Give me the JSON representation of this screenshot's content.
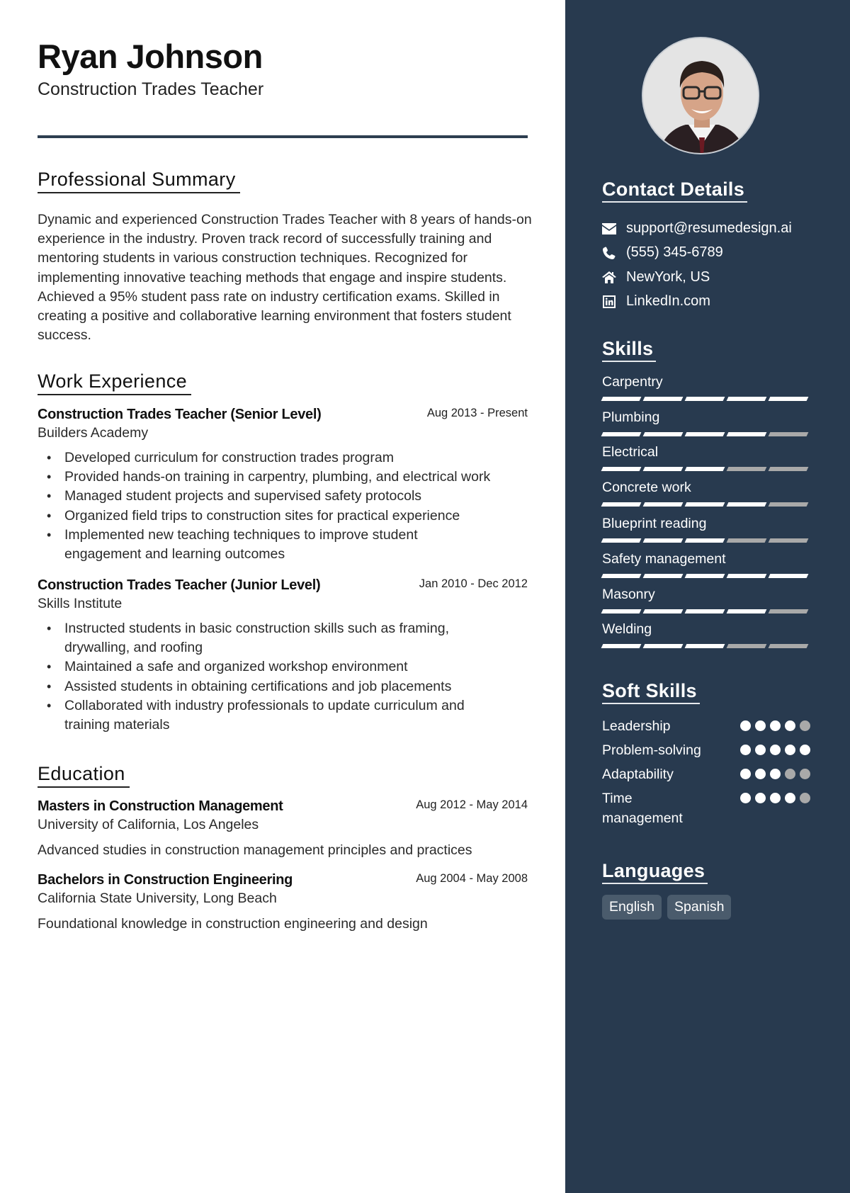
{
  "header": {
    "name": "Ryan Johnson",
    "title": "Construction Trades Teacher"
  },
  "summary": {
    "heading": "Professional Summary",
    "text": "Dynamic and experienced Construction Trades Teacher with 8 years of hands-on experience in the industry. Proven track record of successfully training and mentoring students in various construction techniques. Recognized for implementing innovative teaching methods that engage and inspire students. Achieved a 95% student pass rate on industry certification exams. Skilled in creating a positive and collaborative learning environment that fosters student success."
  },
  "experience": {
    "heading": "Work Experience",
    "jobs": [
      {
        "title": "Construction Trades Teacher (Senior Level)",
        "dates": "Aug 2013 - Present",
        "org": "Builders Academy",
        "bullets": [
          "Developed curriculum for construction trades program",
          "Provided hands-on training in carpentry, plumbing, and electrical work",
          "Managed student projects and supervised safety protocols",
          "Organized field trips to construction sites for practical experience",
          "Implemented new teaching techniques to improve student engagement and learning outcomes"
        ]
      },
      {
        "title": "Construction Trades Teacher (Junior Level)",
        "dates": "Jan 2010 - Dec 2012",
        "org": "Skills Institute",
        "bullets": [
          "Instructed students in basic construction skills such as framing, drywalling, and roofing",
          "Maintained a safe and organized workshop environment",
          "Assisted students in obtaining certifications and job placements",
          "Collaborated with industry professionals to update curriculum and training materials"
        ]
      }
    ]
  },
  "education": {
    "heading": "Education",
    "items": [
      {
        "degree": "Masters in Construction Management",
        "dates": "Aug 2012 - May 2014",
        "school": "University of California, Los Angeles",
        "desc": "Advanced studies in construction management principles and practices"
      },
      {
        "degree": "Bachelors in Construction Engineering",
        "dates": "Aug 2004 - May 2008",
        "school": "California State University, Long Beach",
        "desc": "Foundational knowledge in construction engineering and design"
      }
    ]
  },
  "contact": {
    "heading": "Contact Details",
    "items": [
      {
        "icon": "envelope-icon",
        "value": "support@resumedesign.ai"
      },
      {
        "icon": "phone-icon",
        "value": "(555) 345-6789"
      },
      {
        "icon": "home-icon",
        "value": "NewYork, US"
      },
      {
        "icon": "linkedin-icon",
        "value": "LinkedIn.com"
      }
    ]
  },
  "skills": {
    "heading": "Skills",
    "max": 5,
    "items": [
      {
        "label": "Carpentry",
        "level": 5
      },
      {
        "label": "Plumbing",
        "level": 4
      },
      {
        "label": "Electrical",
        "level": 3
      },
      {
        "label": "Concrete work",
        "level": 4
      },
      {
        "label": "Blueprint reading",
        "level": 3
      },
      {
        "label": "Safety management",
        "level": 5
      },
      {
        "label": "Masonry",
        "level": 4
      },
      {
        "label": "Welding",
        "level": 3
      }
    ]
  },
  "soft_skills": {
    "heading": "Soft Skills",
    "max": 5,
    "items": [
      {
        "label": "Leadership",
        "level": 4
      },
      {
        "label": "Problem-solving",
        "level": 5
      },
      {
        "label": "Adaptability",
        "level": 3
      },
      {
        "label": "Time management",
        "level": 4
      }
    ]
  },
  "languages": {
    "heading": "Languages",
    "items": [
      "English",
      "Spanish"
    ]
  },
  "colors": {
    "sidebar": "#283a4f",
    "rule": "#2d3e50",
    "bar_on": "#ffffff",
    "bar_off": "#a9a9a9"
  }
}
